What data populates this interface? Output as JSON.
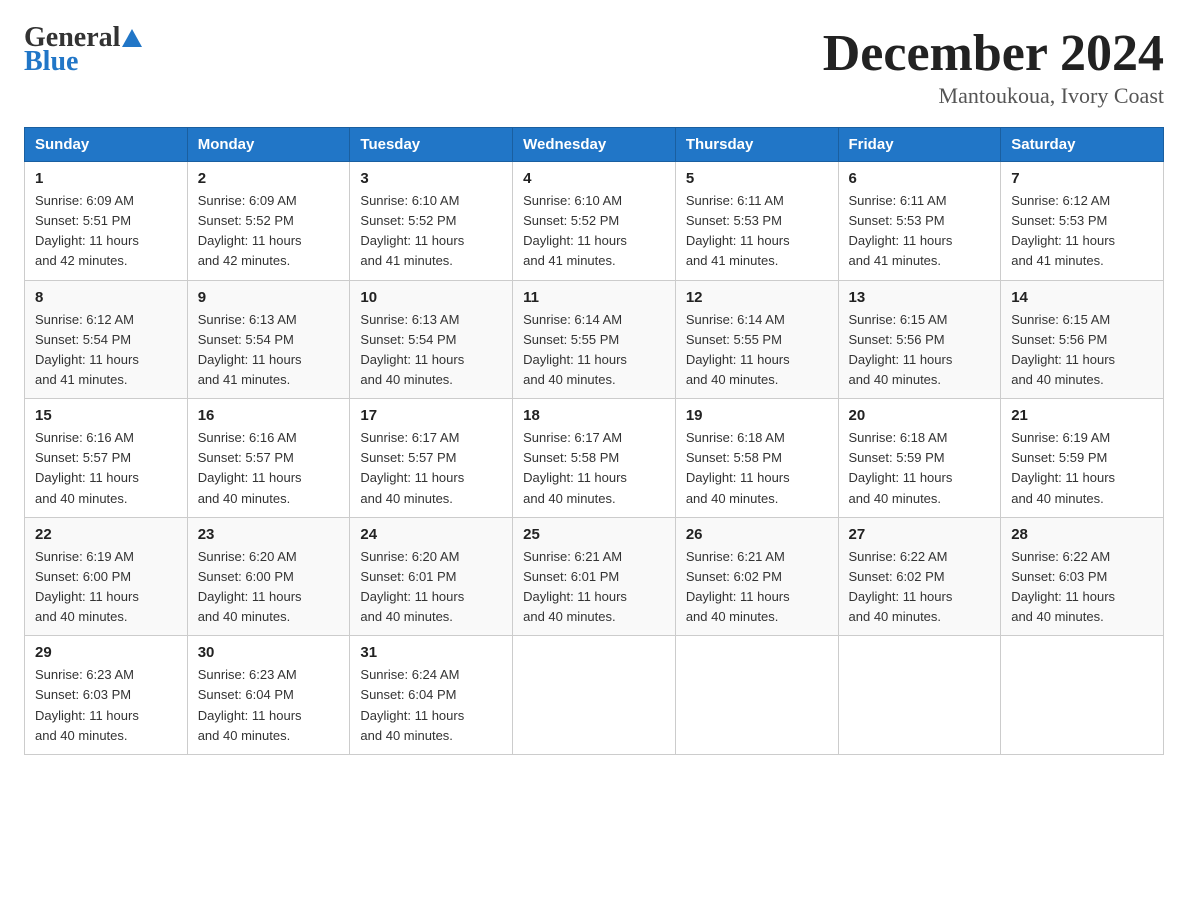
{
  "header": {
    "logo_general": "General",
    "logo_blue": "Blue",
    "month_title": "December 2024",
    "location": "Mantoukoua, Ivory Coast"
  },
  "days_of_week": [
    "Sunday",
    "Monday",
    "Tuesday",
    "Wednesday",
    "Thursday",
    "Friday",
    "Saturday"
  ],
  "weeks": [
    [
      {
        "day": "1",
        "sunrise": "6:09 AM",
        "sunset": "5:51 PM",
        "daylight": "11 hours and 42 minutes."
      },
      {
        "day": "2",
        "sunrise": "6:09 AM",
        "sunset": "5:52 PM",
        "daylight": "11 hours and 42 minutes."
      },
      {
        "day": "3",
        "sunrise": "6:10 AM",
        "sunset": "5:52 PM",
        "daylight": "11 hours and 41 minutes."
      },
      {
        "day": "4",
        "sunrise": "6:10 AM",
        "sunset": "5:52 PM",
        "daylight": "11 hours and 41 minutes."
      },
      {
        "day": "5",
        "sunrise": "6:11 AM",
        "sunset": "5:53 PM",
        "daylight": "11 hours and 41 minutes."
      },
      {
        "day": "6",
        "sunrise": "6:11 AM",
        "sunset": "5:53 PM",
        "daylight": "11 hours and 41 minutes."
      },
      {
        "day": "7",
        "sunrise": "6:12 AM",
        "sunset": "5:53 PM",
        "daylight": "11 hours and 41 minutes."
      }
    ],
    [
      {
        "day": "8",
        "sunrise": "6:12 AM",
        "sunset": "5:54 PM",
        "daylight": "11 hours and 41 minutes."
      },
      {
        "day": "9",
        "sunrise": "6:13 AM",
        "sunset": "5:54 PM",
        "daylight": "11 hours and 41 minutes."
      },
      {
        "day": "10",
        "sunrise": "6:13 AM",
        "sunset": "5:54 PM",
        "daylight": "11 hours and 40 minutes."
      },
      {
        "day": "11",
        "sunrise": "6:14 AM",
        "sunset": "5:55 PM",
        "daylight": "11 hours and 40 minutes."
      },
      {
        "day": "12",
        "sunrise": "6:14 AM",
        "sunset": "5:55 PM",
        "daylight": "11 hours and 40 minutes."
      },
      {
        "day": "13",
        "sunrise": "6:15 AM",
        "sunset": "5:56 PM",
        "daylight": "11 hours and 40 minutes."
      },
      {
        "day": "14",
        "sunrise": "6:15 AM",
        "sunset": "5:56 PM",
        "daylight": "11 hours and 40 minutes."
      }
    ],
    [
      {
        "day": "15",
        "sunrise": "6:16 AM",
        "sunset": "5:57 PM",
        "daylight": "11 hours and 40 minutes."
      },
      {
        "day": "16",
        "sunrise": "6:16 AM",
        "sunset": "5:57 PM",
        "daylight": "11 hours and 40 minutes."
      },
      {
        "day": "17",
        "sunrise": "6:17 AM",
        "sunset": "5:57 PM",
        "daylight": "11 hours and 40 minutes."
      },
      {
        "day": "18",
        "sunrise": "6:17 AM",
        "sunset": "5:58 PM",
        "daylight": "11 hours and 40 minutes."
      },
      {
        "day": "19",
        "sunrise": "6:18 AM",
        "sunset": "5:58 PM",
        "daylight": "11 hours and 40 minutes."
      },
      {
        "day": "20",
        "sunrise": "6:18 AM",
        "sunset": "5:59 PM",
        "daylight": "11 hours and 40 minutes."
      },
      {
        "day": "21",
        "sunrise": "6:19 AM",
        "sunset": "5:59 PM",
        "daylight": "11 hours and 40 minutes."
      }
    ],
    [
      {
        "day": "22",
        "sunrise": "6:19 AM",
        "sunset": "6:00 PM",
        "daylight": "11 hours and 40 minutes."
      },
      {
        "day": "23",
        "sunrise": "6:20 AM",
        "sunset": "6:00 PM",
        "daylight": "11 hours and 40 minutes."
      },
      {
        "day": "24",
        "sunrise": "6:20 AM",
        "sunset": "6:01 PM",
        "daylight": "11 hours and 40 minutes."
      },
      {
        "day": "25",
        "sunrise": "6:21 AM",
        "sunset": "6:01 PM",
        "daylight": "11 hours and 40 minutes."
      },
      {
        "day": "26",
        "sunrise": "6:21 AM",
        "sunset": "6:02 PM",
        "daylight": "11 hours and 40 minutes."
      },
      {
        "day": "27",
        "sunrise": "6:22 AM",
        "sunset": "6:02 PM",
        "daylight": "11 hours and 40 minutes."
      },
      {
        "day": "28",
        "sunrise": "6:22 AM",
        "sunset": "6:03 PM",
        "daylight": "11 hours and 40 minutes."
      }
    ],
    [
      {
        "day": "29",
        "sunrise": "6:23 AM",
        "sunset": "6:03 PM",
        "daylight": "11 hours and 40 minutes."
      },
      {
        "day": "30",
        "sunrise": "6:23 AM",
        "sunset": "6:04 PM",
        "daylight": "11 hours and 40 minutes."
      },
      {
        "day": "31",
        "sunrise": "6:24 AM",
        "sunset": "6:04 PM",
        "daylight": "11 hours and 40 minutes."
      },
      null,
      null,
      null,
      null
    ]
  ],
  "labels": {
    "sunrise": "Sunrise:",
    "sunset": "Sunset:",
    "daylight": "Daylight:"
  }
}
